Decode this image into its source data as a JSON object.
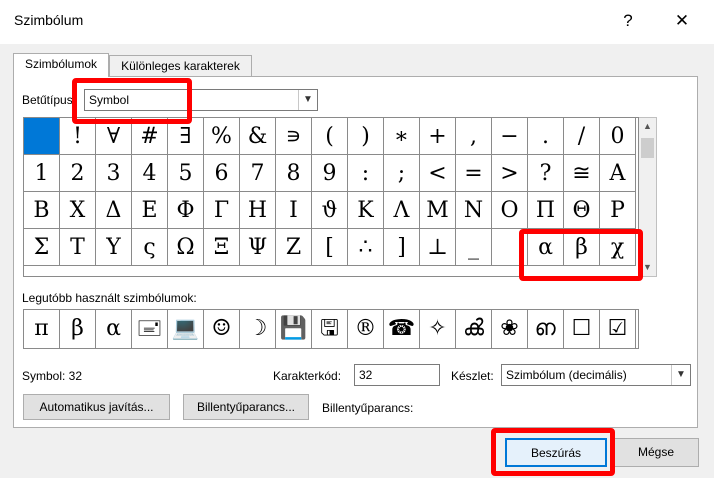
{
  "window": {
    "title": "Szimbólum",
    "help_label": "?",
    "close_label": "✕"
  },
  "tabs": [
    {
      "label": "Szimbólumok",
      "active": true
    },
    {
      "label": "Különleges karakterek",
      "active": false
    }
  ],
  "font": {
    "label": "Betűtípus:",
    "value": "Symbol"
  },
  "symbol_grid": {
    "rows": [
      [
        " ",
        "!",
        "∀",
        "#",
        "∃",
        "%",
        "&",
        "∍",
        "(",
        ")",
        "∗",
        "+",
        ",",
        "−",
        ".",
        "/",
        "0"
      ],
      [
        "1",
        "2",
        "3",
        "4",
        "5",
        "6",
        "7",
        "8",
        "9",
        ":",
        ";",
        "<",
        "=",
        ">",
        "?",
        "≅",
        "Α"
      ],
      [
        "Β",
        "Χ",
        "Δ",
        "Ε",
        "Φ",
        "Γ",
        "Η",
        "Ι",
        "ϑ",
        "Κ",
        "Λ",
        "Μ",
        "Ν",
        "Ο",
        "Π",
        "Θ",
        "Ρ"
      ],
      [
        "Σ",
        "Τ",
        "Υ",
        "ς",
        "Ω",
        "Ξ",
        "Ψ",
        "Ζ",
        "[",
        "∴",
        "]",
        "⊥",
        "_",
        "",
        "α",
        "β",
        "χ"
      ]
    ],
    "selected": [
      0,
      0
    ]
  },
  "recent": {
    "label": "Legutóbb használt szimbólumok:",
    "symbols": [
      "π",
      "β",
      "α",
      "🖃",
      "💻",
      "☺",
      "☽",
      "💾",
      "🖫",
      "®",
      "☎",
      "✧",
      "ൿ",
      "❀",
      "ഩ",
      "☐",
      "☑"
    ]
  },
  "info": {
    "symbol_info": "Symbol: 32",
    "code_label": "Karakterkód:",
    "code_value": "32",
    "set_label": "Készlet:",
    "set_value": "Szimbólum (decimális)"
  },
  "buttons": {
    "autocorrect": "Automatikus javítás...",
    "shortcut_key": "Billentyűparancs...",
    "shortcut_label": "Billentyűparancs:",
    "insert": "Beszúrás",
    "cancel": "Mégse"
  },
  "scroll": {
    "up": "▲",
    "down": "▼"
  },
  "icons": {
    "dropdown": "chevron-down-icon"
  }
}
